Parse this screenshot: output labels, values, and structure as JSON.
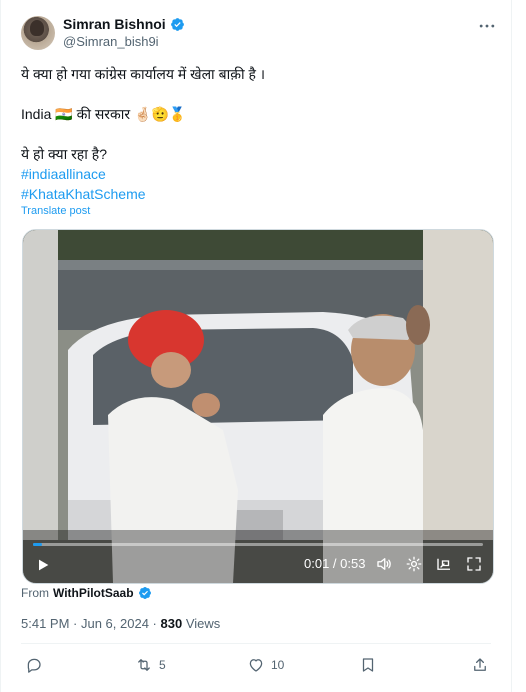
{
  "author": {
    "name": "Simran Bishnoi",
    "handle": "@Simran_bish9i",
    "verified": true
  },
  "post": {
    "lines": [
      "ये क्या हो गया कांग्रेस कार्यालय में खेला बाक़ी है ।",
      "",
      "India 🇮🇳 की सरकार 🤞🏻🫡🥇",
      "",
      "ये हो क्या रहा है?"
    ],
    "hashtags": [
      "#indiaallinace",
      "#KhataKhatScheme"
    ],
    "translate_label": "Translate post"
  },
  "video": {
    "time_current": "0:01",
    "time_separator": " / ",
    "time_total": "0:53",
    "progress": 0.02
  },
  "source": {
    "prefix": "From",
    "name": "WithPilotSaab",
    "verified": true
  },
  "meta": {
    "time": "5:41 PM",
    "sep1": " · ",
    "date": "Jun 6, 2024",
    "sep2": " · ",
    "views_count": "830",
    "views_label": " Views"
  },
  "actions": {
    "reply_count": "",
    "repost_count": "5",
    "like_count": "10"
  },
  "colors": {
    "accent": "#1d9bf0",
    "muted": "#536471",
    "text": "#0f1419"
  }
}
